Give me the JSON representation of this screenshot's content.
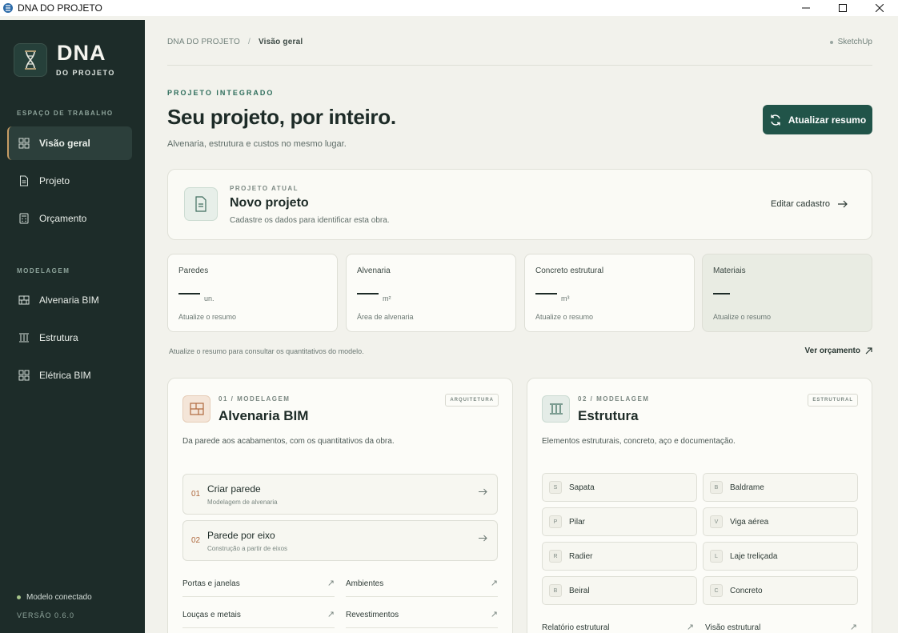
{
  "window": {
    "title": "DNA DO PROJETO"
  },
  "sidebar": {
    "logo_title": "DNA",
    "logo_subtitle": "DO PROJETO",
    "section_workspace": "ESPAÇO DE TRABALHO",
    "workspace_items": [
      {
        "label": "Visão geral",
        "icon": "grid-icon",
        "active": true
      },
      {
        "label": "Projeto",
        "icon": "document-icon",
        "active": false
      },
      {
        "label": "Orçamento",
        "icon": "calculator-icon",
        "active": false
      }
    ],
    "section_modeling": "MODELAGEM",
    "modeling_items": [
      {
        "label": "Alvenaria BIM",
        "icon": "wall-icon"
      },
      {
        "label": "Estrutura",
        "icon": "columns-icon"
      },
      {
        "label": "Elétrica BIM",
        "icon": "grid-icon"
      }
    ],
    "status": "Modelo conectado",
    "version": "VERSÃO 0.6.0"
  },
  "header": {
    "breadcrumb_root": "DNA DO PROJETO",
    "breadcrumb_sep": "/",
    "breadcrumb_current": "Visão geral",
    "sketchup_status": "SketchUp"
  },
  "hero": {
    "eyebrow": "PROJETO INTEGRADO",
    "title": "Seu projeto, por inteiro.",
    "subtitle": "Alvenaria, estrutura e custos no mesmo lugar.",
    "refresh_button": "Atualizar resumo"
  },
  "project": {
    "eyebrow": "PROJETO ATUAL",
    "title": "Novo projeto",
    "subtitle": "Cadastre os dados para identificar esta obra.",
    "edit_link": "Editar cadastro"
  },
  "stats": [
    {
      "label": "Paredes",
      "unit": "un.",
      "hint": "Atualize o resumo"
    },
    {
      "label": "Alvenaria",
      "unit": "m²",
      "hint": "Área de alvenaria"
    },
    {
      "label": "Concreto estrutural",
      "unit": "m³",
      "hint": "Atualize o resumo"
    },
    {
      "label": "Materiais",
      "unit": "",
      "hint": "Atualize o resumo"
    }
  ],
  "stats_note": "Atualize o resumo para consultar os quantitativos do modelo.",
  "budget_link": "Ver orçamento",
  "masonry": {
    "eyebrow": "01 / MODELAGEM",
    "title": "Alvenaria BIM",
    "badge": "ARQUITETURA",
    "description": "Da parede aos acabamentos, com os quantitativos da obra.",
    "steps": [
      {
        "num": "01",
        "title": "Criar parede",
        "subtitle": "Modelagem de alvenaria"
      },
      {
        "num": "02",
        "title": "Parede por eixo",
        "subtitle": "Construção a partir de eixos"
      }
    ],
    "links": [
      "Portas e janelas",
      "Ambientes",
      "Louças e metais",
      "Revestimentos"
    ]
  },
  "structure": {
    "eyebrow": "02 / MODELAGEM",
    "title": "Estrutura",
    "badge": "ESTRUTURAL",
    "description": "Elementos estruturais, concreto, aço e documentação.",
    "elements": [
      {
        "key": "S",
        "label": "Sapata"
      },
      {
        "key": "B",
        "label": "Baldrame"
      },
      {
        "key": "P",
        "label": "Pilar"
      },
      {
        "key": "V",
        "label": "Viga aérea"
      },
      {
        "key": "R",
        "label": "Radier"
      },
      {
        "key": "L",
        "label": "Laje treliçada"
      },
      {
        "key": "B",
        "label": "Beiral"
      },
      {
        "key": "C",
        "label": "Concreto"
      }
    ],
    "links": [
      "Relatório estrutural",
      "Visão estrutural"
    ]
  },
  "colors": {
    "sidebar_bg": "#1d2c29",
    "accent": "#215449",
    "page_bg": "#f2f2ec",
    "active_marker": "#c79c64"
  }
}
